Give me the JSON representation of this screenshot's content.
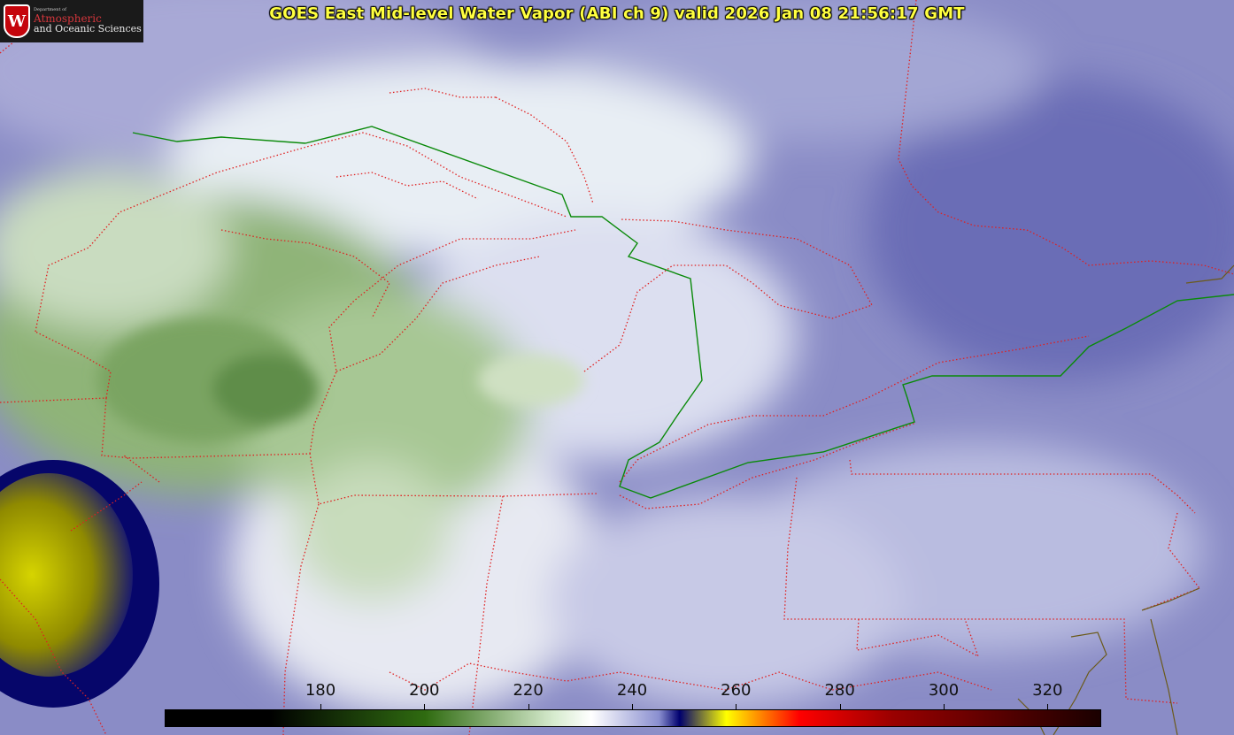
{
  "header": {
    "title": "GOES East Mid-level Water Vapor (ABI ch 9)  valid 2026 Jan 08 21:56:17 GMT"
  },
  "logo": {
    "dept": "Department of",
    "line1": "Atmospheric",
    "line2": "and Oceanic Sciences",
    "crest_letter": "W"
  },
  "colorbar": {
    "min": 150,
    "max": 330,
    "ticks": [
      {
        "value": 180,
        "label": "180"
      },
      {
        "value": 200,
        "label": "200"
      },
      {
        "value": 220,
        "label": "220"
      },
      {
        "value": 240,
        "label": "240"
      },
      {
        "value": 260,
        "label": "260"
      },
      {
        "value": 280,
        "label": "280"
      },
      {
        "value": 300,
        "label": "300"
      },
      {
        "value": 320,
        "label": "320"
      }
    ],
    "stops": [
      {
        "value": 170,
        "color": "#000000"
      },
      {
        "value": 200,
        "color": "#2f6b10"
      },
      {
        "value": 225,
        "color": "#d8ecd0"
      },
      {
        "value": 232,
        "color": "#ffffff"
      },
      {
        "value": 245,
        "color": "#8a8fd0"
      },
      {
        "value": 249,
        "color": "#00006e"
      },
      {
        "value": 258,
        "color": "#ffff00"
      },
      {
        "value": 264,
        "color": "#ff9000"
      },
      {
        "value": 272,
        "color": "#ff0000"
      },
      {
        "value": 290,
        "color": "#9a0000"
      },
      {
        "value": 330,
        "color": "#1a0000"
      }
    ]
  },
  "colors": {
    "border_dotted": "#e02020",
    "intl_border": "#0a8a0a",
    "coast": "#6b5a1a"
  }
}
